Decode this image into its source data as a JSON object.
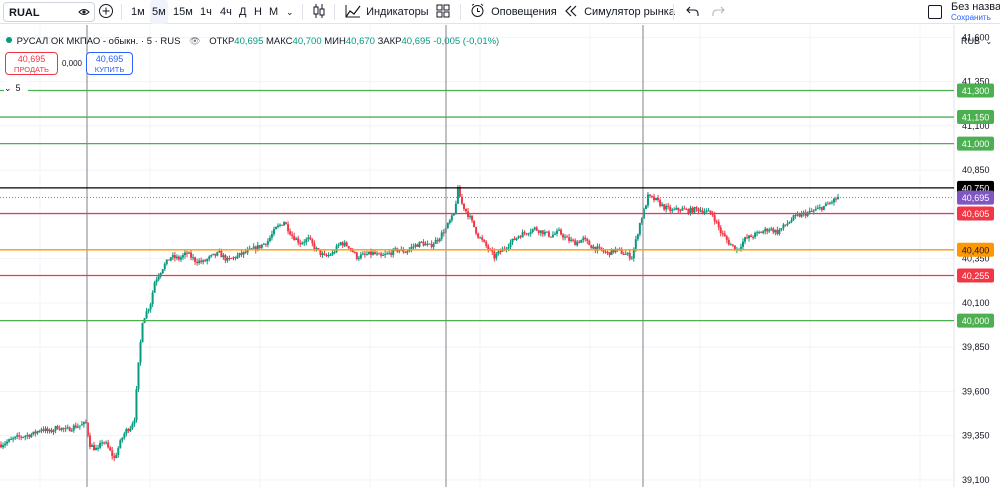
{
  "toolbar": {
    "symbol": "RUAL",
    "intervals": [
      "1м",
      "5м",
      "15м",
      "1ч",
      "4ч",
      "Д",
      "Н",
      "М"
    ],
    "active_interval": "5м",
    "indicators_label": "Индикаторы",
    "alerts_label": "Оповещения",
    "replay_label": "Симулятор рынка",
    "layout_title": "Без назван",
    "save_label": "Сохранить"
  },
  "legend": {
    "title": "РУСАЛ ОК МКПАО - обыкн. · 5 · RUS",
    "open_label": "ОТКР",
    "open": "40,695",
    "high_label": "МАКС",
    "high": "40,700",
    "low_label": "МИН",
    "low": "40,670",
    "close_label": "ЗАКР",
    "close": "40,695",
    "change": "-0,005 (-0,01%)",
    "sell_price": "40,695",
    "sell_label": "ПРОДАТЬ",
    "spread": "0,000",
    "buy_price": "40,695",
    "buy_label": "КУПИТЬ",
    "indicators_count": "5"
  },
  "colors": {
    "up": "#089981",
    "down": "#f23645",
    "green_level": "#4caf50",
    "red_level": "#f23645",
    "orange_level": "#ff9800",
    "black_level": "#000000",
    "price_label": "#7e57c2",
    "grid": "#f0f3fa"
  },
  "chart_data": {
    "type": "candlestick",
    "currency": "RUB",
    "y_axis_ticks": [
      41.6,
      41.35,
      41.1,
      40.85,
      40.6,
      40.35,
      40.1,
      39.85,
      39.6,
      39.35,
      39.1
    ],
    "y_axis_tick_labels": [
      "41,600",
      "41,350",
      "41,100",
      "40,850",
      "40,600",
      "40,350",
      "40,100",
      "39,850",
      "39,600",
      "39,350",
      "39,100"
    ],
    "ylim": [
      39.06,
      41.67
    ],
    "current_price": 40.695,
    "current_price_label": "40,695",
    "levels": [
      {
        "value": 41.3,
        "label": "41,300",
        "color": "#4caf50"
      },
      {
        "value": 41.15,
        "label": "41,150",
        "color": "#4caf50"
      },
      {
        "value": 41.0,
        "label": "41,000",
        "color": "#4caf50"
      },
      {
        "value": 40.75,
        "label": "40,750",
        "color": "#000000"
      },
      {
        "value": 40.605,
        "label": "40,605",
        "color": "#f23645"
      },
      {
        "value": 40.4,
        "label": "40,400",
        "color": "#ff9800"
      },
      {
        "value": 40.255,
        "label": "40,255",
        "color": "#f23645"
      },
      {
        "value": 40.0,
        "label": "40,000",
        "color": "#4caf50"
      }
    ],
    "session_breaks": [
      1,
      2
    ],
    "close_path": [
      [
        0,
        39.3
      ],
      [
        4,
        39.34
      ],
      [
        8,
        39.36
      ],
      [
        10,
        39.39
      ],
      [
        12,
        39.37
      ],
      [
        14,
        39.4
      ],
      [
        16,
        39.38
      ],
      [
        18,
        39.4
      ],
      [
        20,
        39.41
      ],
      [
        21,
        39.42
      ],
      [
        22,
        39.3
      ],
      [
        23,
        39.28
      ],
      [
        24,
        39.27
      ],
      [
        25,
        39.32
      ],
      [
        26,
        39.3
      ],
      [
        27,
        39.26
      ],
      [
        28,
        39.22
      ],
      [
        29,
        39.28
      ],
      [
        30,
        39.34
      ],
      [
        31,
        39.38
      ],
      [
        32,
        39.4
      ],
      [
        33,
        39.45
      ],
      [
        34,
        39.75
      ],
      [
        35,
        40.0
      ],
      [
        36,
        40.05
      ],
      [
        37,
        40.1
      ],
      [
        38,
        40.22
      ],
      [
        39,
        40.26
      ],
      [
        40,
        40.3
      ],
      [
        42,
        40.36
      ],
      [
        44,
        40.35
      ],
      [
        46,
        40.38
      ],
      [
        48,
        40.34
      ],
      [
        50,
        40.33
      ],
      [
        52,
        40.36
      ],
      [
        54,
        40.38
      ],
      [
        56,
        40.34
      ],
      [
        58,
        40.36
      ],
      [
        60,
        40.38
      ],
      [
        62,
        40.4
      ],
      [
        64,
        40.42
      ],
      [
        66,
        40.45
      ],
      [
        68,
        40.52
      ],
      [
        70,
        40.56
      ],
      [
        72,
        40.48
      ],
      [
        74,
        40.44
      ],
      [
        76,
        40.46
      ],
      [
        78,
        40.4
      ],
      [
        80,
        40.36
      ],
      [
        82,
        40.38
      ],
      [
        84,
        40.44
      ],
      [
        86,
        40.42
      ],
      [
        88,
        40.36
      ],
      [
        90,
        40.37
      ],
      [
        92,
        40.38
      ],
      [
        94,
        40.36
      ],
      [
        96,
        40.38
      ],
      [
        98,
        40.4
      ],
      [
        100,
        40.39
      ],
      [
        102,
        40.42
      ],
      [
        104,
        40.44
      ],
      [
        106,
        40.42
      ],
      [
        108,
        40.46
      ],
      [
        110,
        40.52
      ],
      [
        112,
        40.6
      ],
      [
        113,
        40.74
      ],
      [
        114,
        40.66
      ],
      [
        116,
        40.58
      ],
      [
        118,
        40.48
      ],
      [
        120,
        40.42
      ],
      [
        122,
        40.36
      ],
      [
        124,
        40.4
      ],
      [
        126,
        40.44
      ],
      [
        128,
        40.48
      ],
      [
        130,
        40.5
      ],
      [
        132,
        40.52
      ],
      [
        134,
        40.5
      ],
      [
        136,
        40.48
      ],
      [
        138,
        40.5
      ],
      [
        140,
        40.46
      ],
      [
        142,
        40.44
      ],
      [
        144,
        40.46
      ],
      [
        146,
        40.42
      ],
      [
        148,
        40.4
      ],
      [
        150,
        40.38
      ],
      [
        152,
        40.4
      ],
      [
        154,
        40.38
      ],
      [
        156,
        40.36
      ],
      [
        157,
        40.45
      ],
      [
        158,
        40.55
      ],
      [
        159,
        40.62
      ],
      [
        160,
        40.7
      ],
      [
        162,
        40.68
      ],
      [
        164,
        40.64
      ],
      [
        166,
        40.62
      ],
      [
        168,
        40.63
      ],
      [
        170,
        40.62
      ],
      [
        172,
        40.63
      ],
      [
        174,
        40.62
      ],
      [
        176,
        40.6
      ],
      [
        178,
        40.5
      ],
      [
        180,
        40.44
      ],
      [
        182,
        40.4
      ],
      [
        184,
        40.46
      ],
      [
        186,
        40.48
      ],
      [
        188,
        40.5
      ],
      [
        190,
        40.52
      ],
      [
        192,
        40.5
      ],
      [
        194,
        40.54
      ],
      [
        196,
        40.58
      ],
      [
        198,
        40.6
      ],
      [
        200,
        40.61
      ],
      [
        202,
        40.63
      ],
      [
        204,
        40.65
      ],
      [
        206,
        40.68
      ],
      [
        207,
        40.695
      ]
    ]
  }
}
